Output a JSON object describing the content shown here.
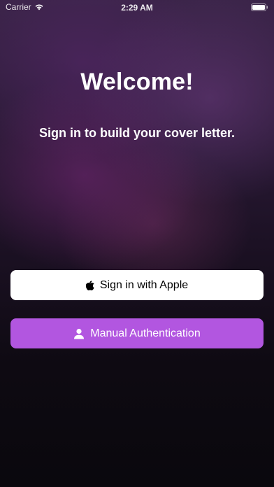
{
  "status_bar": {
    "carrier": "Carrier",
    "time": "2:29 AM"
  },
  "main": {
    "title": "Welcome!",
    "subtitle": "Sign in to build your cover letter."
  },
  "buttons": {
    "apple_label": "Sign in with Apple",
    "manual_label": "Manual Authentication"
  },
  "icons": {
    "apple": "apple-logo-icon",
    "manual": "person-icon",
    "wifi": "wifi-icon",
    "battery": "battery-icon"
  },
  "colors": {
    "manual_button": "#b256e0",
    "apple_button": "#ffffff"
  }
}
